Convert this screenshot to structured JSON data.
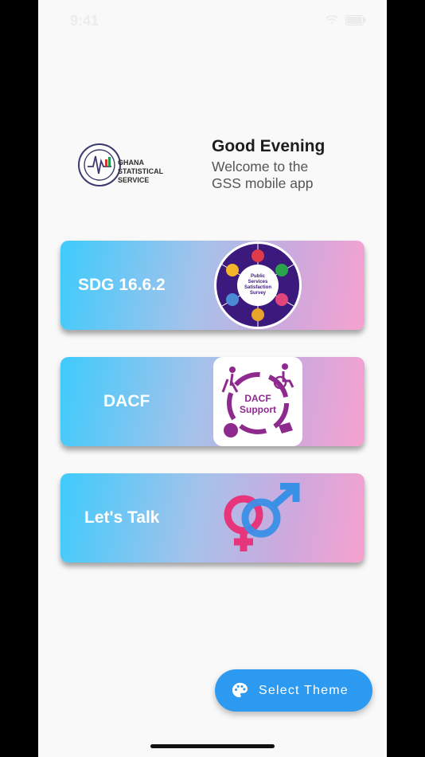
{
  "status_bar": {
    "time": "9:41",
    "icons": [
      "wifi-icon",
      "battery-icon"
    ]
  },
  "header": {
    "logo_text_lines": [
      "GHANA",
      "STATISTICAL",
      "SERVICE"
    ],
    "logo_ring_top": "STATISTICAL SERVICE",
    "logo_ring_bottom": "GHANA",
    "greeting": "Good Evening",
    "welcome": "Welcome to the GSS mobile app"
  },
  "cards": [
    {
      "label": "SDG 16.6.2",
      "image_text": [
        "Public",
        "Services",
        "Satisfaction",
        "Survey"
      ]
    },
    {
      "label": "DACF",
      "image_text": [
        "DACF",
        "Support"
      ]
    },
    {
      "label": "Let's Talk",
      "image_icon": "gender-symbols-icon"
    }
  ],
  "theme_button": {
    "label": "Select Theme",
    "icon": "palette-icon"
  },
  "colors": {
    "gradient_start": "#3ecbfc",
    "gradient_end": "#f7a2cf",
    "fab": "#2d9af1",
    "survey_purple": "#3c1a7d",
    "dacf_purple": "#8e2a8e",
    "female_symbol": "#e6357a",
    "male_symbol": "#3a8fe6"
  }
}
